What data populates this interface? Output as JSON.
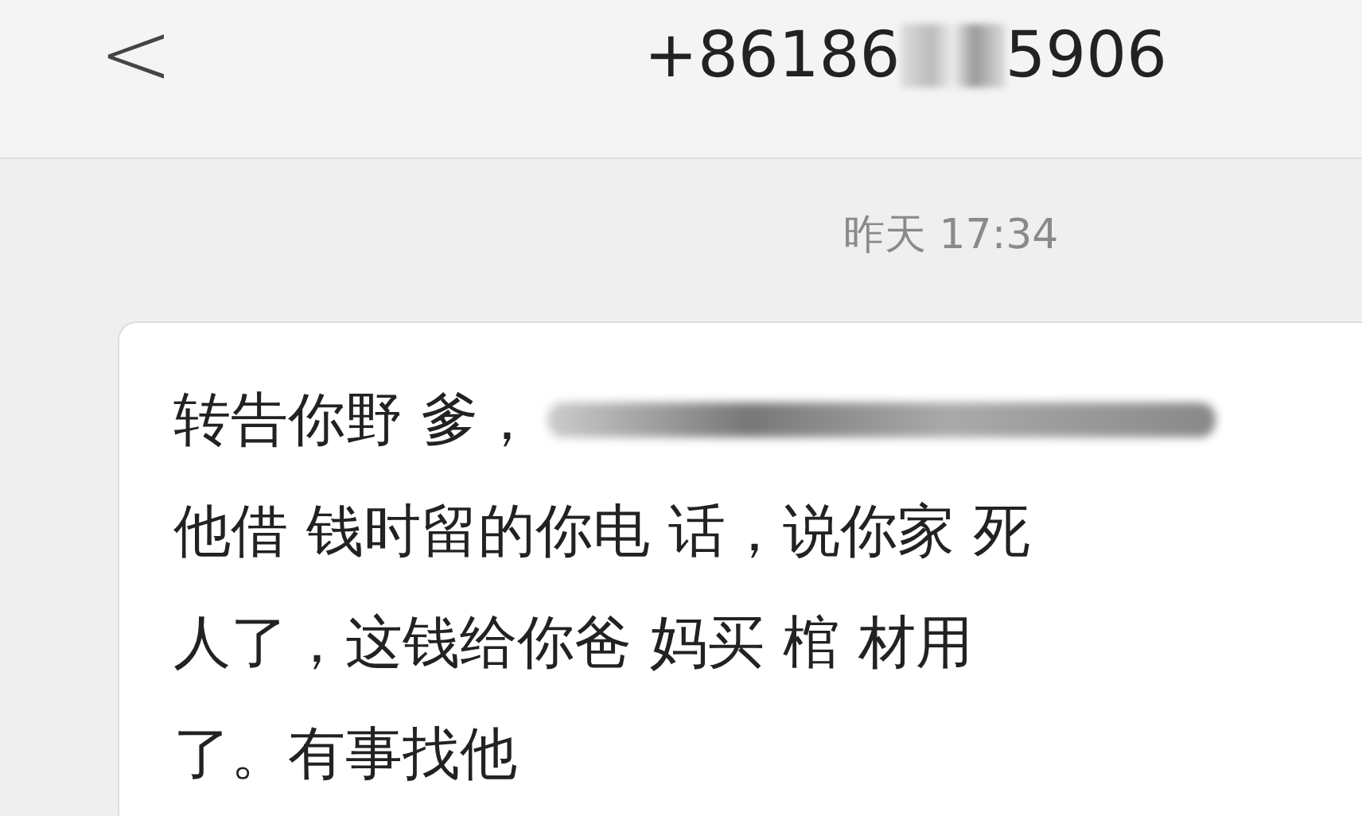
{
  "header": {
    "back": "<",
    "number_start": "+86186",
    "number_end": "5906"
  },
  "timestamp": "昨天 17:34",
  "message": {
    "lines": [
      {
        "text": "转告你野 爹，",
        "redacted_after": true
      },
      {
        "text": "他借 钱时留的你电 话，说你家 死",
        "redacted_after": false
      },
      {
        "text": "人了，这钱给你爸 妈买 棺 材用",
        "redacted_after": false
      },
      {
        "text": "了。有事找他",
        "redacted_after": false
      }
    ]
  }
}
